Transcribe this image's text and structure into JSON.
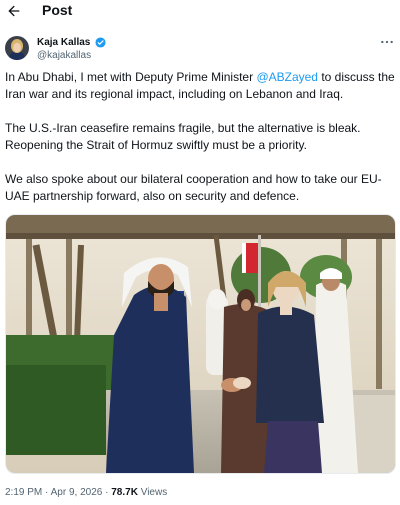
{
  "header": {
    "title": "Post",
    "back_icon": "back-arrow-icon"
  },
  "author": {
    "name": "Kaja Kallas",
    "handle": "@kajakallas",
    "verified_color": "#1d9bf0"
  },
  "post": {
    "p1_before": "In Abu Dhabi, I met with Deputy Prime Minister ",
    "mention": "@ABZayed",
    "p1_after": " to discuss the",
    "p1_line2": "Iran war and its regional impact, including on Lebanon and Iraq.",
    "p2_line1": "The U.S.-Iran ceasefire remains fragile, but the alternative is bleak.",
    "p2_line2": "Reopening the Strait of Hormuz swiftly must be a priority.",
    "p3_line1": "We also spoke about our bilateral cooperation and how to take our EU-",
    "p3_line2": "UAE partnership forward, also on security and defence."
  },
  "meta": {
    "time": "2:19 PM",
    "date": "Apr 9, 2026",
    "views": "78.7K",
    "views_label": "Views",
    "separator": "·"
  },
  "colors": {
    "accent": "#1d9bf0",
    "text": "#0f1419",
    "secondary": "#536471"
  }
}
